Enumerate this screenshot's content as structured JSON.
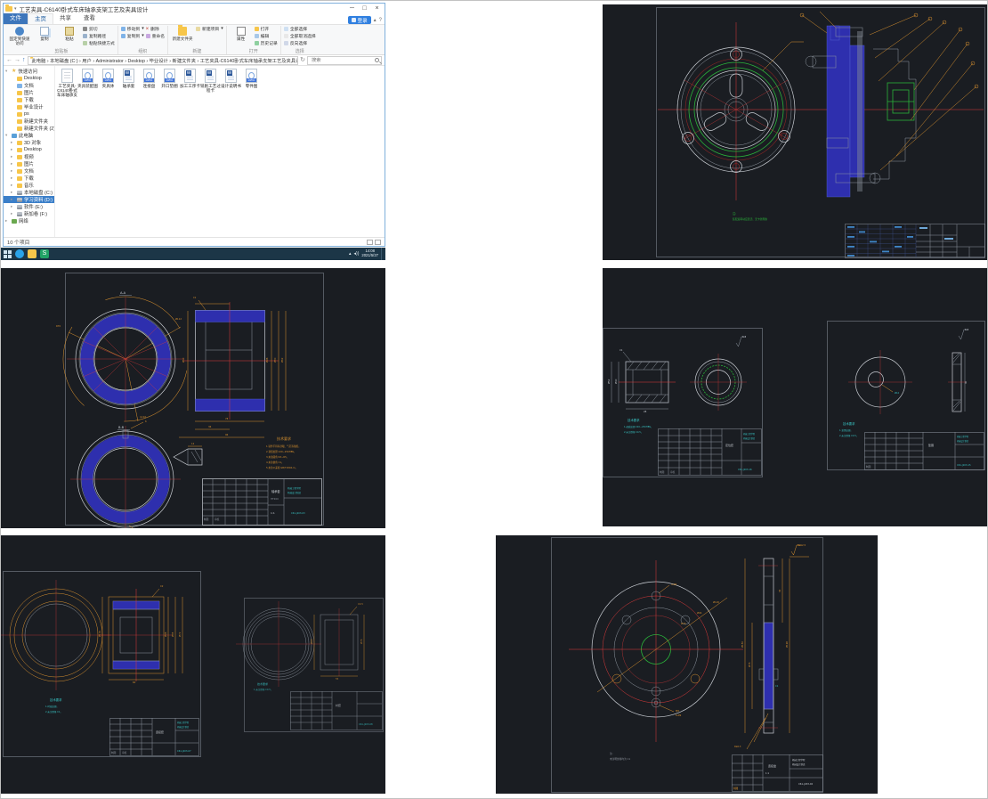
{
  "explorer": {
    "title": "工艺夹具-C6140卧式车床轴承支架工艺及夹具设计",
    "tabs": {
      "file": "文件",
      "home": "主页",
      "share": "共享",
      "view": "查看"
    },
    "account_button": "登录",
    "ribbon": {
      "groups": [
        {
          "label": "剪贴板",
          "pin": "固定到快速访问",
          "copy": "复制",
          "paste": "粘贴",
          "cut": "剪切",
          "copy_path": "复制路径",
          "paste_shortcut": "粘贴快捷方式"
        },
        {
          "label": "组织",
          "move_to": "移动到",
          "copy_to": "复制到",
          "delete": "删除",
          "rename": "重命名"
        },
        {
          "label": "新建",
          "new_folder": "新建文件夹",
          "new_item": "新建项目"
        },
        {
          "label": "打开",
          "properties": "属性",
          "open": "打开",
          "edit": "编辑",
          "history": "历史记录"
        },
        {
          "label": "选择",
          "select_all": "全部选择",
          "select_none": "全部取消选择",
          "invert": "反向选择"
        }
      ]
    },
    "breadcrumb": "此电脑 › 本地磁盘 (C:) › 用户 › Administrator › Desktop › 毕业设计 › 新建文件夹 › 工艺夹具-C6140卧式车床轴承支架工艺及夹具设计 ›",
    "search_placeholder": "搜索",
    "sidebar": {
      "quick": {
        "label": "快速访问",
        "items": [
          "Desktop",
          "文档",
          "图片",
          "下载",
          "毕业设计",
          "ps",
          "新建文件夹",
          "新建文件夹 (2)"
        ]
      },
      "this_pc": {
        "label": "此电脑",
        "items": [
          "3D 对象",
          "Desktop",
          "视频",
          "图片",
          "文档",
          "下载",
          "音乐",
          "本地磁盘 (C:)",
          "学习资料 (D:)",
          "软件 (E:)",
          "新加卷 (F:)"
        ]
      },
      "network": {
        "label": "网络"
      }
    },
    "files": [
      {
        "name": "工艺夹具-C6140卧式车床轴承支架工艺及夹具设计",
        "type": "txt"
      },
      {
        "name": "夹具装配图",
        "type": "dwg"
      },
      {
        "name": "夹具体",
        "type": "dwg"
      },
      {
        "name": "轴承套",
        "type": "doc"
      },
      {
        "name": "连接盘",
        "type": "dwg"
      },
      {
        "name": "开口垫圈",
        "type": "dwg"
      },
      {
        "name": "加工工序卡",
        "type": "doc"
      },
      {
        "name": "铣削工艺过程卡",
        "type": "doc"
      },
      {
        "name": "设计说明书",
        "type": "doc"
      },
      {
        "name": "零件图",
        "type": "dwg"
      }
    ],
    "status": "10 个项目"
  },
  "taskbar": {
    "time": "14:08",
    "date": "2021/5/27"
  },
  "common": {
    "tech_title": "技术要求",
    "draw": "制图",
    "check": "审核",
    "scale_label": "比例",
    "qty_label": "数量",
    "material_label": "材料",
    "scale": "1:1"
  },
  "drawings": {
    "assembly": {
      "note1": "注:",
      "note2": "装配后转动应灵活、无卡滞现象"
    },
    "bushing": {
      "label_aa": "A-A",
      "label_bb": "B-B",
      "tech_lines": [
        "1.铸件不得有砂眼、气孔等缺陷。",
        "2.调质处理 220~250HBS。",
        "3.未注圆角 R3~R5。",
        "4.未注倒角 C1。",
        "5.未注公差按 GB/T1804-m。"
      ],
      "dims": {
        "d1": "Ø112",
        "d2": "R70",
        "d3": "4×10",
        "d4": "Ø96",
        "d5": "Ø80",
        "d6": "Ø62",
        "d7": "78",
        "d8": "36",
        "d9": "96",
        "d10": "Ø50",
        "d11": "C1",
        "d12": "12",
        "d13": "6"
      },
      "part": "轴承套",
      "material": "HT200",
      "school1": "机械工程学院",
      "school2": "机械设计制造",
      "no": "C61-J203-03"
    },
    "sleeve": {
      "tech_lines": [
        "1.调质处理 220~250HBS。",
        "2.未注倒角 C0.5。"
      ],
      "dims": {
        "d1": "Ø40",
        "d2": "Ø52",
        "d3": "C1",
        "d4": "28",
        "d5": "6.3"
      },
      "part": "定位套",
      "school1": "机械工程学院",
      "school2": "机械设计制造",
      "no": "C61-J203-16"
    },
    "washer": {
      "tech_lines": [
        "1.发黑处理。",
        "2.未注倒角 C0.5。"
      ],
      "dims": {
        "d1": "Ø12",
        "d2": "40",
        "d3": "6.3"
      },
      "part": "垫圈",
      "school1": "机械工程学院",
      "school2": "机械设计制造",
      "no": "C61-J203-15"
    },
    "ring": {
      "tech_lines": [
        "1.时效处理。",
        "2.未注倒角 C1。"
      ],
      "dims": {
        "d1": "Ø105",
        "d2": "Ø96",
        "d3": "Ø85",
        "d4": "Ø72",
        "d5": "60",
        "d6": "C2"
      },
      "part": "连接套",
      "school1": "机械工程学院",
      "school2": "机械设计制造",
      "no": "C61-J203-07"
    },
    "liner": {
      "tech_lines": [
        "1.未注倒角 C0.5。"
      ],
      "dims": {
        "d1": "Ø68",
        "d2": "Ø76",
        "d3": "55",
        "d4": "C0.5"
      },
      "part": "衬套",
      "no": "C61-J203-08"
    },
    "flange": {
      "note1": "注:",
      "note2": "未注明倒角均为 C1",
      "dims": {
        "d1": "Ø76",
        "d2": "Ø94",
        "d3": "Ø120",
        "d4": "M8",
        "d5": "6-Ø9",
        "d6": "4-Ø9",
        "d7": "Ø180",
        "d8": "Ø76",
        "d9": "35",
        "d10": "Ø196",
        "d11": "Ra6.3",
        "d12": "C1",
        "d13": "Ra12.5"
      },
      "part": "连接盘",
      "school1": "机械工程学院",
      "school2": "机械设计制造",
      "no": "C61-J203-02"
    }
  }
}
